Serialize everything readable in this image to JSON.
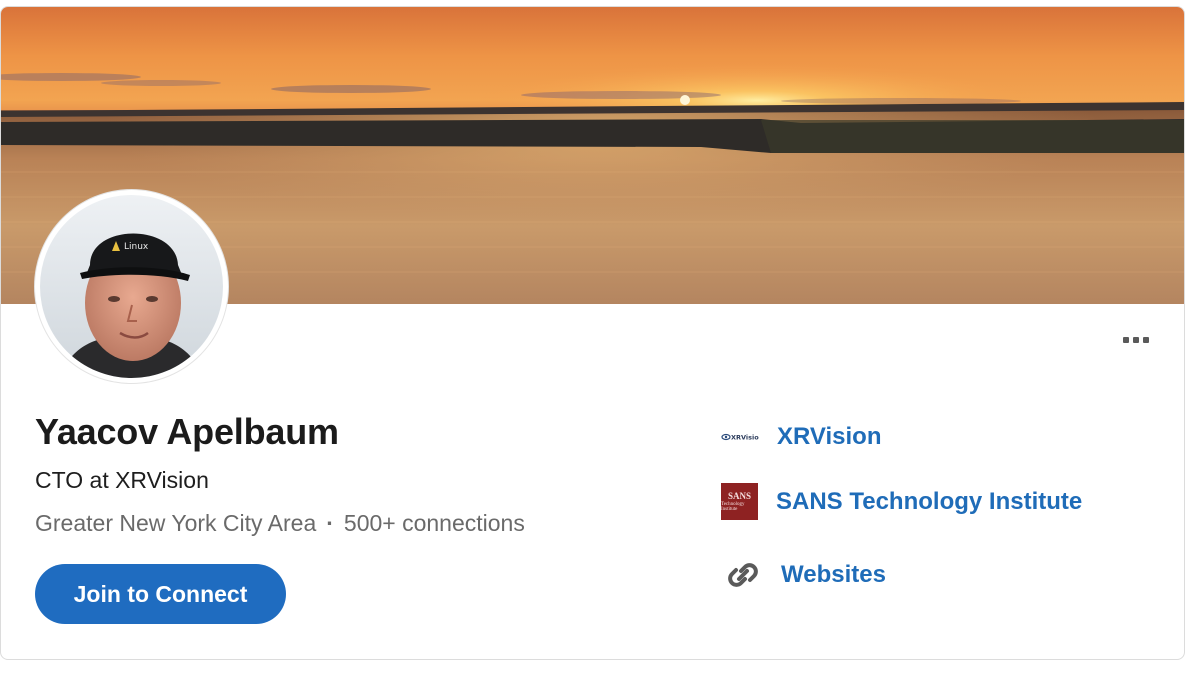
{
  "profile": {
    "name": "Yaacov Apelbaum",
    "headline": "CTO at XRVision",
    "location": "Greater New York City Area",
    "separator": "·",
    "connections": "500+ connections",
    "cap_text": "Linux"
  },
  "actions": {
    "join_label": "Join to Connect",
    "more_icon": "ellipsis-icon"
  },
  "links": {
    "company": {
      "label": "XRVision",
      "logo_text": "XRVision"
    },
    "school": {
      "label": "SANS Technology Institute",
      "logo_line1": "SANS",
      "logo_line2": "Technology Institute"
    },
    "websites": {
      "label": "Websites",
      "icon": "link-icon"
    }
  },
  "colors": {
    "brand_blue": "#1f6cc0",
    "link_blue": "#1f6cb8",
    "sans_red": "#8e2222"
  }
}
